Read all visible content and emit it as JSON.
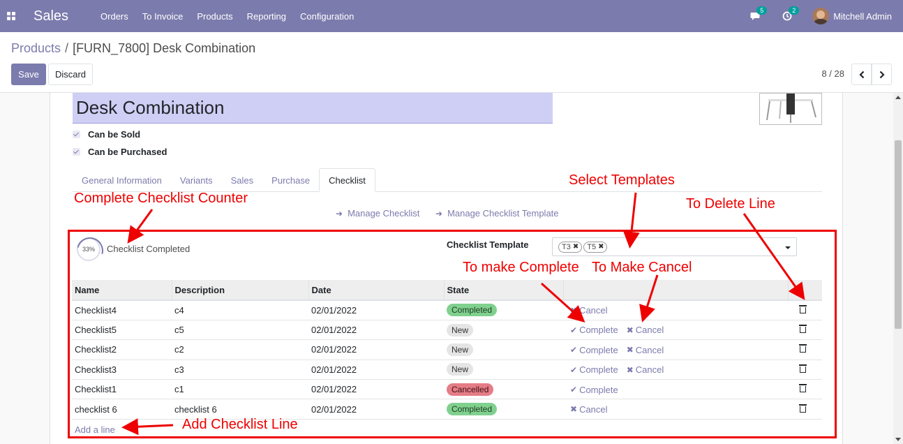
{
  "navbar": {
    "app_name": "Sales",
    "menu": [
      "Orders",
      "To Invoice",
      "Products",
      "Reporting",
      "Configuration"
    ],
    "messages_count": "5",
    "activities_count": "2",
    "user_name": "Mitchell Admin",
    "bg_color": "#7c7bad"
  },
  "breadcrumb": {
    "parent": "Products",
    "separator": "/",
    "current": "[FURN_7800] Desk Combination"
  },
  "buttons": {
    "save": "Save",
    "discard": "Discard"
  },
  "pager": {
    "text": "8 / 28"
  },
  "form": {
    "product_name": "Desk Combination",
    "can_be_sold_label": "Can be Sold",
    "can_be_sold": true,
    "can_be_purchased_label": "Can be Purchased",
    "can_be_purchased": true,
    "tabs": [
      "General Information",
      "Variants",
      "Sales",
      "Purchase",
      "Checklist"
    ],
    "active_tab": "Checklist",
    "manage_checklist": "Manage Checklist",
    "manage_checklist_template": "Manage Checklist Template",
    "progress_percent": "33%",
    "progress_value": 0.33,
    "progress_label": "Checklist Completed",
    "template_label": "Checklist Template",
    "template_tags": [
      "T3",
      "T5"
    ]
  },
  "table": {
    "columns": [
      "Name",
      "Description",
      "Date",
      "State"
    ],
    "rows": [
      {
        "name": "Checklist4",
        "description": "c4",
        "date": "02/01/2022",
        "state": "Completed",
        "state_class": "completed",
        "complete": false,
        "cancel": true
      },
      {
        "name": "Checklist5",
        "description": "c5",
        "date": "02/01/2022",
        "state": "New",
        "state_class": "new",
        "complete": true,
        "cancel": true
      },
      {
        "name": "Checklist2",
        "description": "c2",
        "date": "02/01/2022",
        "state": "New",
        "state_class": "new",
        "complete": true,
        "cancel": true
      },
      {
        "name": "Checklist3",
        "description": "c3",
        "date": "02/01/2022",
        "state": "New",
        "state_class": "new",
        "complete": true,
        "cancel": true
      },
      {
        "name": "Checklist1",
        "description": "c1",
        "date": "02/01/2022",
        "state": "Cancelled",
        "state_class": "cancelled",
        "complete": true,
        "cancel": false
      },
      {
        "name": "checklist 6",
        "description": "checklist 6",
        "date": "02/01/2022",
        "state": "Completed",
        "state_class": "completed",
        "complete": false,
        "cancel": true
      }
    ],
    "complete_label": "Complete",
    "cancel_label": "Cancel",
    "add_line": "Add a line"
  },
  "annotations": {
    "counter": "Complete Checklist Counter",
    "select_templates": "Select Templates",
    "delete_line": "To Delete Line",
    "make_complete": "To make Complete",
    "make_cancel": "To Make Cancel",
    "add_line": "Add Checklist Line",
    "color": "#ee0000"
  }
}
